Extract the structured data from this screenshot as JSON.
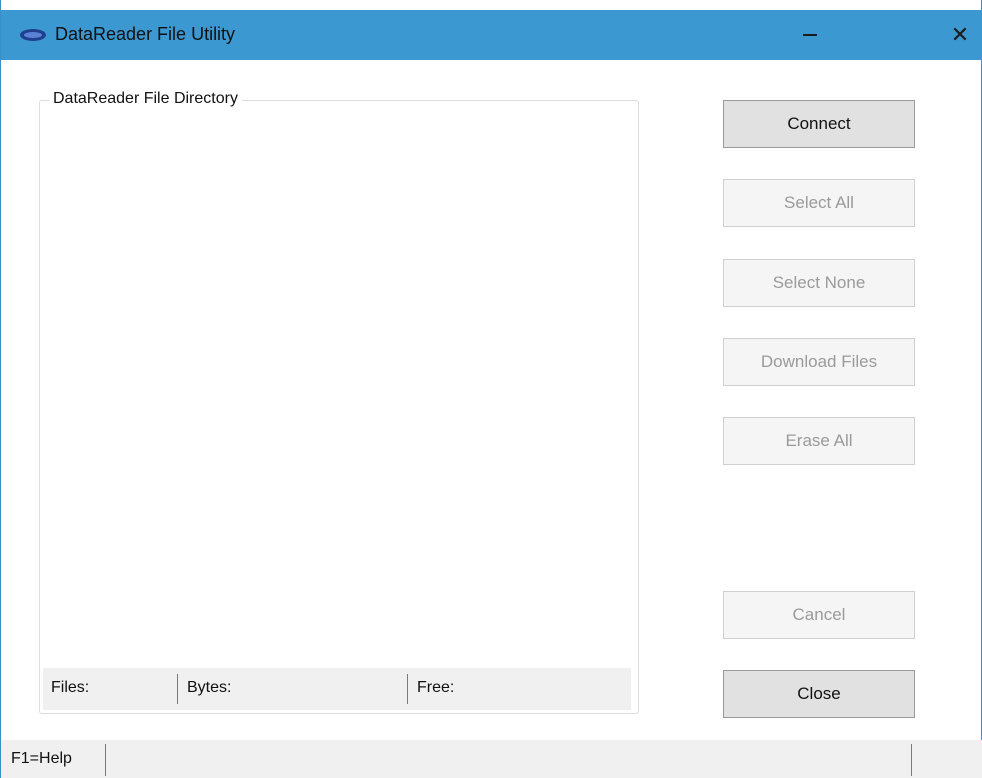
{
  "window": {
    "title": "DataReader File Utility",
    "minimize_symbol": "—",
    "close_symbol": "✕",
    "titlebar_color": "#3c98d0"
  },
  "directory": {
    "group_label": "DataReader File Directory",
    "files_label": "Files:",
    "bytes_label": "Bytes:",
    "free_label": "Free:"
  },
  "buttons": {
    "connect": "Connect",
    "select_all": "Select All",
    "select_none": "Select None",
    "download_files": "Download Files",
    "erase_all": "Erase All",
    "cancel": "Cancel",
    "close": "Close"
  },
  "statusbar": {
    "help": "F1=Help"
  }
}
